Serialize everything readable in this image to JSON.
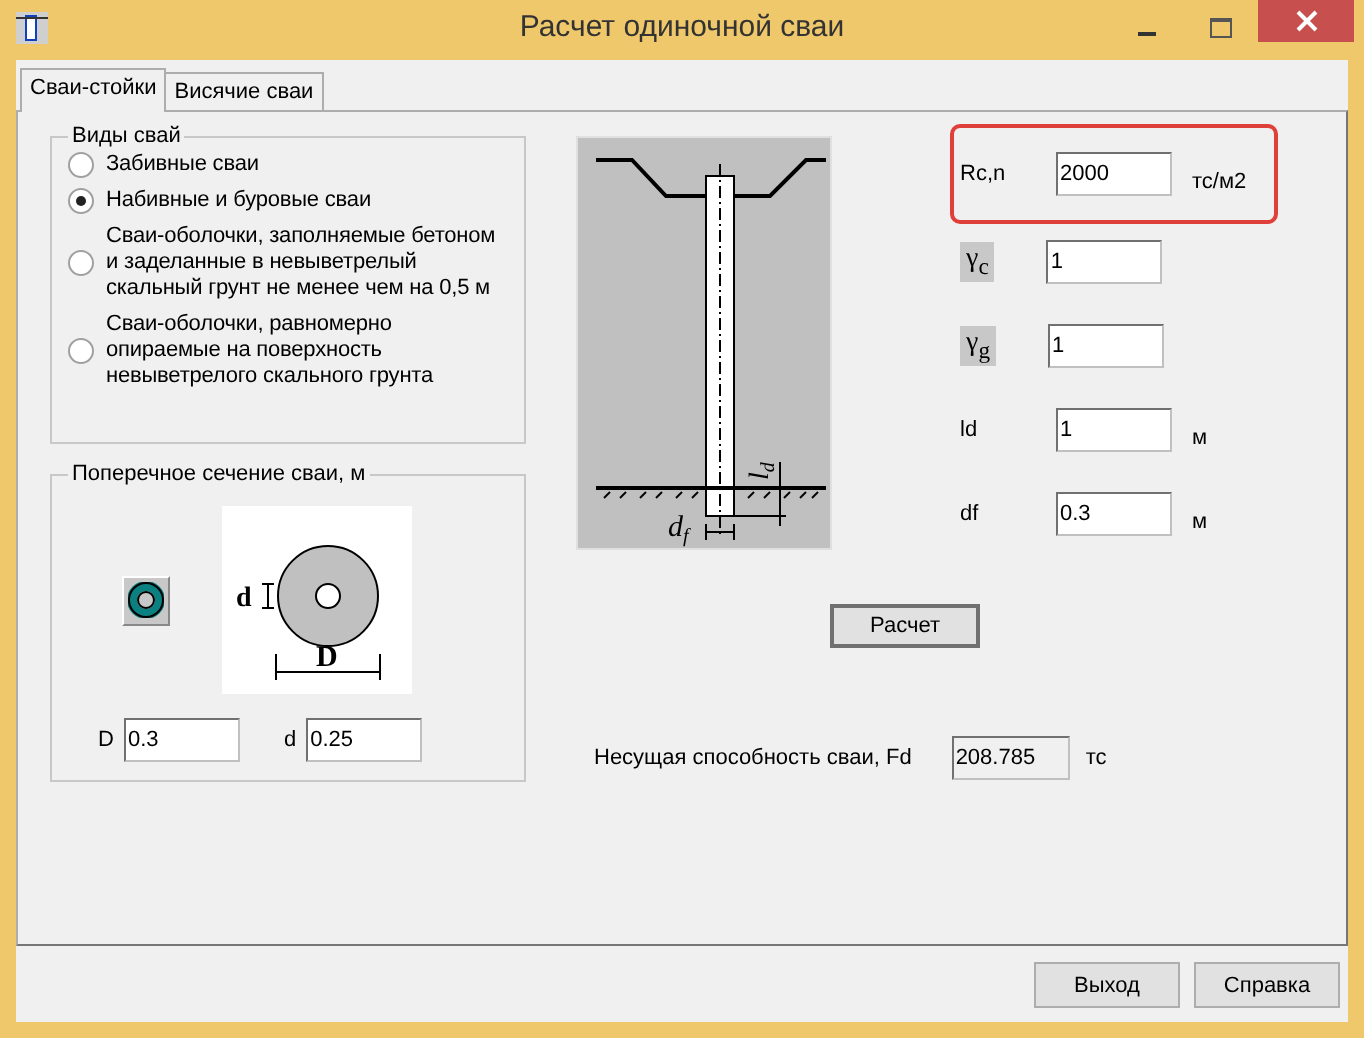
{
  "window": {
    "title": "Расчет одиночной сваи"
  },
  "tabs": [
    {
      "label": "Сваи-стойки",
      "selected": true
    },
    {
      "label": "Висячие сваи",
      "selected": false
    }
  ],
  "pile_types": {
    "title": "Виды свай",
    "options": [
      {
        "label": "Забивные сваи",
        "selected": false
      },
      {
        "label": "Набивные и буровые сваи",
        "selected": true
      },
      {
        "label": "Сваи-оболочки, заполняемые бетоном и заделанные в невыветрелый скальный грунт не менее чем на 0,5 м",
        "selected": false
      },
      {
        "label": "Сваи-оболочки, равномерно опираемые на поверхность невыветрелого скального грунта",
        "selected": false
      }
    ]
  },
  "cross_section": {
    "title": "Поперечное сечение сваи, м",
    "inner_label": "d",
    "outer_label": "D",
    "fields": [
      {
        "label": "D",
        "value": "0.3"
      },
      {
        "label": "d",
        "value": "0.25"
      }
    ]
  },
  "diagram": {
    "depth_label": {
      "symbol": "l",
      "subscript": "d"
    },
    "width_label": {
      "symbol": "d",
      "subscript": "f"
    }
  },
  "params": [
    {
      "kind": "text",
      "label": "Rc,n",
      "value": "2000",
      "unit": "тс/м2",
      "highlighted": true
    },
    {
      "kind": "symbol",
      "label": "γ$_{c}$",
      "value": "1",
      "highlighted": false
    },
    {
      "kind": "symbol",
      "label": "γ$_{g}$",
      "value": "1",
      "highlighted": false
    },
    {
      "kind": "text",
      "label": "ld",
      "value": "1",
      "unit": "м",
      "highlighted": false
    },
    {
      "kind": "text",
      "label": "df",
      "value": "0.3",
      "unit": "м",
      "highlighted": false
    }
  ],
  "calculate_button": "Расчет",
  "result": {
    "label": "Несущая способность сваи, Fd",
    "value": "208.785",
    "unit": "тс"
  },
  "buttons": [
    "Выход",
    "Справка"
  ]
}
